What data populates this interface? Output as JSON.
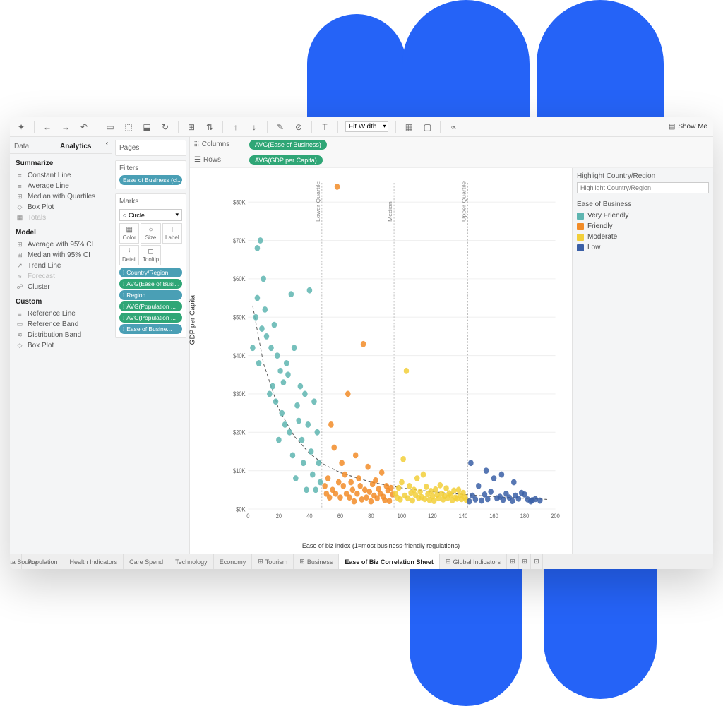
{
  "toolbar": {
    "fit": "Fit Width",
    "showme": "Show Me"
  },
  "sidebar": {
    "tabs": [
      "Data",
      "Analytics"
    ],
    "sections": [
      {
        "title": "Summarize",
        "items": [
          {
            "icon": "≡",
            "label": "Constant Line"
          },
          {
            "icon": "≡",
            "label": "Average Line"
          },
          {
            "icon": "⊞",
            "label": "Median with Quartiles"
          },
          {
            "icon": "◇",
            "label": "Box Plot"
          },
          {
            "icon": "▦",
            "label": "Totals",
            "disabled": true
          }
        ]
      },
      {
        "title": "Model",
        "items": [
          {
            "icon": "⊞",
            "label": "Average with 95% CI"
          },
          {
            "icon": "⊞",
            "label": "Median with 95% CI"
          },
          {
            "icon": "↗",
            "label": "Trend Line"
          },
          {
            "icon": "≈",
            "label": "Forecast",
            "disabled": true
          },
          {
            "icon": "☍",
            "label": "Cluster"
          }
        ]
      },
      {
        "title": "Custom",
        "items": [
          {
            "icon": "≡",
            "label": "Reference Line"
          },
          {
            "icon": "▭",
            "label": "Reference Band"
          },
          {
            "icon": "≋",
            "label": "Distribution Band"
          },
          {
            "icon": "◇",
            "label": "Box Plot"
          }
        ]
      }
    ]
  },
  "shelves": {
    "pages": "Pages",
    "filters": "Filters",
    "filterPill": "Ease of Business (cl...",
    "marks": "Marks",
    "markType": "Circle",
    "markButtons": [
      "Color",
      "Size",
      "Label",
      "Detail",
      "Tooltip"
    ],
    "markPills": [
      {
        "cls": "blue",
        "label": "Country/Region"
      },
      {
        "cls": "green",
        "label": "AVG(Ease of Busi..."
      },
      {
        "cls": "blue",
        "label": "Region"
      },
      {
        "cls": "green",
        "label": "AVG(Population ..."
      },
      {
        "cls": "green",
        "label": "AVG(Population ..."
      },
      {
        "cls": "blue",
        "label": "Ease of Busine..."
      }
    ]
  },
  "main": {
    "columns": "Columns",
    "columnsPill": "AVG(Ease of Business)",
    "rows": "Rows",
    "rowsPill": "AVG(GDP per Capita)"
  },
  "right": {
    "highlight": "Highlight Country/Region",
    "highlightPh": "Highlight Country/Region",
    "legendTitle": "Ease of Business",
    "legend": [
      {
        "c": "#5eb5b0",
        "label": "Very Friendly"
      },
      {
        "c": "#f28c28",
        "label": "Friendly"
      },
      {
        "c": "#f2cf3a",
        "label": "Moderate"
      },
      {
        "c": "#3a5fa6",
        "label": "Low"
      }
    ]
  },
  "tabs": [
    "Data Source",
    "Population",
    "Health Indicators",
    "Care Spend",
    "Technology",
    "Economy",
    "Tourism",
    "Business",
    "Ease of Biz Correlation Sheet",
    "Global Indicators"
  ],
  "activeTab": 8,
  "chart_data": {
    "type": "scatter",
    "title": "",
    "xlabel": "Ease of biz index (1=most business-friendly regulations)",
    "ylabel": "GDP per Capita",
    "xlim": [
      0,
      200
    ],
    "ylim": [
      0,
      85000
    ],
    "yticks": [
      0,
      10000,
      20000,
      30000,
      40000,
      50000,
      60000,
      70000,
      80000
    ],
    "xticks": [
      0,
      20,
      40,
      60,
      80,
      100,
      120,
      140,
      160,
      180,
      200
    ],
    "references": [
      {
        "x": 48,
        "label": "Lower Quartile"
      },
      {
        "x": 95,
        "label": "Median"
      },
      {
        "x": 143,
        "label": "Upper Quartile"
      }
    ],
    "series": [
      {
        "name": "Very Friendly",
        "color": "#5eb5b0",
        "points": [
          [
            3,
            42000
          ],
          [
            5,
            50000
          ],
          [
            6,
            55000
          ],
          [
            7,
            38000
          ],
          [
            8,
            70000
          ],
          [
            9,
            47000
          ],
          [
            10,
            60000
          ],
          [
            12,
            45000
          ],
          [
            14,
            30000
          ],
          [
            15,
            42000
          ],
          [
            16,
            32000
          ],
          [
            17,
            48000
          ],
          [
            18,
            28000
          ],
          [
            19,
            40000
          ],
          [
            20,
            18000
          ],
          [
            21,
            36000
          ],
          [
            22,
            25000
          ],
          [
            23,
            33000
          ],
          [
            24,
            22000
          ],
          [
            25,
            38000
          ],
          [
            26,
            35000
          ],
          [
            27,
            20000
          ],
          [
            28,
            56000
          ],
          [
            29,
            14000
          ],
          [
            30,
            42000
          ],
          [
            31,
            8000
          ],
          [
            32,
            27000
          ],
          [
            33,
            23000
          ],
          [
            34,
            32000
          ],
          [
            35,
            18000
          ],
          [
            36,
            12000
          ],
          [
            37,
            30000
          ],
          [
            38,
            5000
          ],
          [
            39,
            22000
          ],
          [
            40,
            57000
          ],
          [
            41,
            15000
          ],
          [
            42,
            9000
          ],
          [
            43,
            28000
          ],
          [
            44,
            5000
          ],
          [
            45,
            20000
          ],
          [
            46,
            12000
          ],
          [
            47,
            7000
          ],
          [
            6,
            68000
          ],
          [
            11,
            52000
          ]
        ]
      },
      {
        "name": "Friendly",
        "color": "#f28c28",
        "points": [
          [
            50,
            6000
          ],
          [
            51,
            4000
          ],
          [
            52,
            8000
          ],
          [
            53,
            3000
          ],
          [
            54,
            22000
          ],
          [
            55,
            5000
          ],
          [
            56,
            16000
          ],
          [
            57,
            4000
          ],
          [
            58,
            84000
          ],
          [
            59,
            7000
          ],
          [
            60,
            3000
          ],
          [
            61,
            12000
          ],
          [
            62,
            6000
          ],
          [
            63,
            9000
          ],
          [
            64,
            4000
          ],
          [
            65,
            30000
          ],
          [
            66,
            3000
          ],
          [
            67,
            7000
          ],
          [
            68,
            5000
          ],
          [
            69,
            2000
          ],
          [
            70,
            14000
          ],
          [
            71,
            4000
          ],
          [
            72,
            8000
          ],
          [
            73,
            6000
          ],
          [
            74,
            2500
          ],
          [
            75,
            43000
          ],
          [
            76,
            5000
          ],
          [
            77,
            3000
          ],
          [
            78,
            11000
          ],
          [
            79,
            4500
          ],
          [
            80,
            2000
          ],
          [
            81,
            6500
          ],
          [
            82,
            3500
          ],
          [
            83,
            7500
          ],
          [
            84,
            2800
          ],
          [
            85,
            5200
          ],
          [
            86,
            4000
          ],
          [
            87,
            9500
          ],
          [
            88,
            3200
          ],
          [
            89,
            2300
          ],
          [
            90,
            6000
          ],
          [
            91,
            4800
          ],
          [
            92,
            2100
          ],
          [
            93,
            5500
          ],
          [
            94,
            3800
          ]
        ]
      },
      {
        "name": "Moderate",
        "color": "#f2cf3a",
        "points": [
          [
            96,
            4000
          ],
          [
            97,
            3000
          ],
          [
            98,
            5500
          ],
          [
            99,
            2500
          ],
          [
            100,
            7000
          ],
          [
            101,
            13000
          ],
          [
            102,
            3500
          ],
          [
            103,
            36000
          ],
          [
            104,
            2800
          ],
          [
            105,
            6000
          ],
          [
            106,
            4200
          ],
          [
            107,
            2200
          ],
          [
            108,
            5000
          ],
          [
            109,
            3600
          ],
          [
            110,
            8000
          ],
          [
            111,
            2900
          ],
          [
            112,
            4500
          ],
          [
            113,
            3100
          ],
          [
            114,
            9000
          ],
          [
            115,
            2600
          ],
          [
            116,
            5800
          ],
          [
            117,
            3900
          ],
          [
            118,
            2400
          ],
          [
            119,
            4700
          ],
          [
            120,
            3300
          ],
          [
            121,
            2100
          ],
          [
            122,
            5100
          ],
          [
            123,
            3700
          ],
          [
            124,
            2800
          ],
          [
            125,
            6200
          ],
          [
            126,
            4000
          ],
          [
            127,
            2500
          ],
          [
            128,
            3400
          ],
          [
            129,
            5400
          ],
          [
            130,
            2900
          ],
          [
            131,
            4100
          ],
          [
            132,
            3600
          ],
          [
            133,
            2300
          ],
          [
            134,
            4800
          ],
          [
            135,
            3000
          ],
          [
            136,
            2700
          ],
          [
            137,
            5000
          ],
          [
            138,
            3500
          ],
          [
            139,
            2600
          ],
          [
            140,
            4200
          ],
          [
            141,
            3100
          ],
          [
            142,
            2400
          ]
        ]
      },
      {
        "name": "Low",
        "color": "#3a5fa6",
        "points": [
          [
            144,
            2000
          ],
          [
            145,
            12000
          ],
          [
            146,
            3500
          ],
          [
            148,
            2500
          ],
          [
            150,
            6000
          ],
          [
            152,
            2200
          ],
          [
            154,
            3800
          ],
          [
            155,
            10000
          ],
          [
            156,
            2600
          ],
          [
            158,
            4500
          ],
          [
            160,
            8000
          ],
          [
            162,
            2800
          ],
          [
            164,
            3200
          ],
          [
            165,
            9000
          ],
          [
            166,
            2400
          ],
          [
            168,
            4000
          ],
          [
            170,
            3000
          ],
          [
            172,
            2100
          ],
          [
            173,
            7000
          ],
          [
            174,
            3500
          ],
          [
            176,
            2700
          ],
          [
            178,
            4200
          ],
          [
            180,
            3800
          ],
          [
            182,
            2500
          ],
          [
            184,
            2000
          ],
          [
            185,
            2300
          ],
          [
            187,
            2600
          ],
          [
            190,
            2200
          ]
        ]
      }
    ],
    "trend": [
      [
        3,
        53000
      ],
      [
        10,
        38000
      ],
      [
        20,
        26000
      ],
      [
        30,
        19000
      ],
      [
        40,
        14500
      ],
      [
        50,
        11500
      ],
      [
        60,
        9500
      ],
      [
        80,
        7000
      ],
      [
        100,
        5500
      ],
      [
        120,
        4500
      ],
      [
        140,
        3800
      ],
      [
        160,
        3200
      ],
      [
        180,
        2800
      ],
      [
        195,
        2500
      ]
    ]
  }
}
